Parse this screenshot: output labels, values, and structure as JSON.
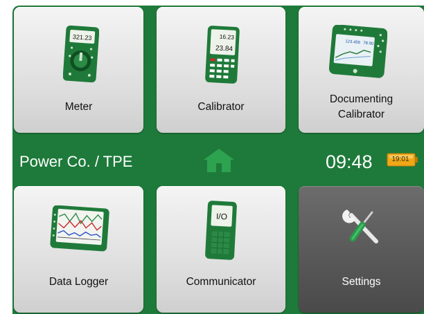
{
  "tiles": {
    "meter": {
      "label": "Meter",
      "display_values": [
        "321.23"
      ]
    },
    "calibrator": {
      "label": "Calibrator",
      "display_values": [
        "16.23",
        "23.84"
      ]
    },
    "documenting_calibrator": {
      "label_line1": "Documenting",
      "label_line2": "Calibrator",
      "display_values": [
        "123.456",
        "78.90"
      ]
    },
    "data_logger": {
      "label": "Data Logger"
    },
    "communicator": {
      "label": "Communicator",
      "screen_text": "I/O"
    },
    "settings": {
      "label": "Settings",
      "icon": "wrench-screwdriver-icon"
    }
  },
  "status_bar": {
    "location": "Power Co. / TPE",
    "home_icon": "home-icon",
    "time": "09:48",
    "battery_label": "19:01"
  },
  "colors": {
    "frame_green": "#1e7a3a",
    "tile_light": "#e6e6e6",
    "settings_tile": "#5a5a5a",
    "home_icon": "#2da24f",
    "battery_fill": "#f0a818"
  }
}
